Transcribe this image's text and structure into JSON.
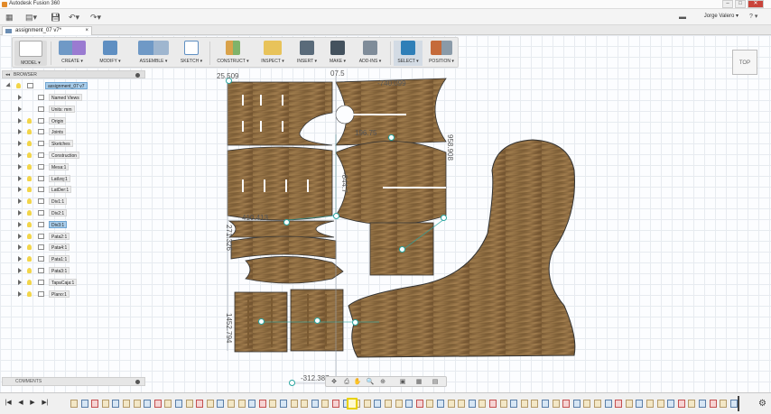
{
  "window": {
    "title": "Autodesk Fusion 360",
    "user": "Jorge Valero ▾",
    "help_label": "? ▾"
  },
  "document_tab": {
    "label": "assignment_07 v7*",
    "close": "×"
  },
  "toolbar": {
    "model": "MODEL ▾",
    "create": "CREATE ▾",
    "modify": "MODIFY ▾",
    "assemble": "ASSEMBLE ▾",
    "sketch": "SKETCH ▾",
    "construct": "CONSTRUCT ▾",
    "inspect": "INSPECT ▾",
    "insert": "INSERT ▾",
    "make": "MAKE ▾",
    "addins": "ADD-INS ▾",
    "select": "SELECT ▾",
    "position": "POSITION ▾"
  },
  "viewcube": {
    "label": "TOP"
  },
  "browser": {
    "header": "BROWSER",
    "root": "assignment_07 v7",
    "items": [
      {
        "label": "Named Views",
        "kind": "folder"
      },
      {
        "label": "Units: mm",
        "kind": "units"
      },
      {
        "label": "Origin",
        "kind": "folder"
      },
      {
        "label": "Joints",
        "kind": "folder"
      },
      {
        "label": "Sketches",
        "kind": "folder"
      },
      {
        "label": "Construction",
        "kind": "folder"
      },
      {
        "label": "Mesa:1",
        "kind": "component"
      },
      {
        "label": "LatIzq:1",
        "kind": "component"
      },
      {
        "label": "LatDer:1",
        "kind": "component"
      },
      {
        "label": "Div1:1",
        "kind": "component"
      },
      {
        "label": "Div2:1",
        "kind": "component"
      },
      {
        "label": "Div3:1",
        "kind": "component",
        "selected": true
      },
      {
        "label": "Pata2:1",
        "kind": "component"
      },
      {
        "label": "Pata4:1",
        "kind": "component"
      },
      {
        "label": "Pata1:1",
        "kind": "component"
      },
      {
        "label": "Pata3:1",
        "kind": "component"
      },
      {
        "label": "TapaCaja:1",
        "kind": "component"
      },
      {
        "label": "Plano:1",
        "kind": "component"
      }
    ]
  },
  "comments": {
    "label": "COMMENTS"
  },
  "dimensions": {
    "d1": "25.509",
    "d2": "-740.099",
    "d3": "07.5",
    "d4": "958.908",
    "d5": "-844.7",
    "d6": "410.413",
    "d7": "271.326",
    "d8": "1452.794",
    "d9": "-312.387",
    "d10": "196.75"
  },
  "colors": {
    "wood": "#8a6a3f",
    "sketch_accent": "#2aa6a0",
    "selection": "#a9cdea",
    "timeline_current": "#e8d100"
  },
  "navbar": {
    "orbit": "✥",
    "look": "⎙",
    "pan": "✋",
    "zoom": "🔍",
    "fit": "⊕",
    "display": "▣",
    "grid": "▦",
    "viewports": "▤"
  },
  "timeline": {
    "first": "|◀",
    "prev": "◀",
    "play": "▶",
    "next": "▶|",
    "settings": "⚙"
  }
}
